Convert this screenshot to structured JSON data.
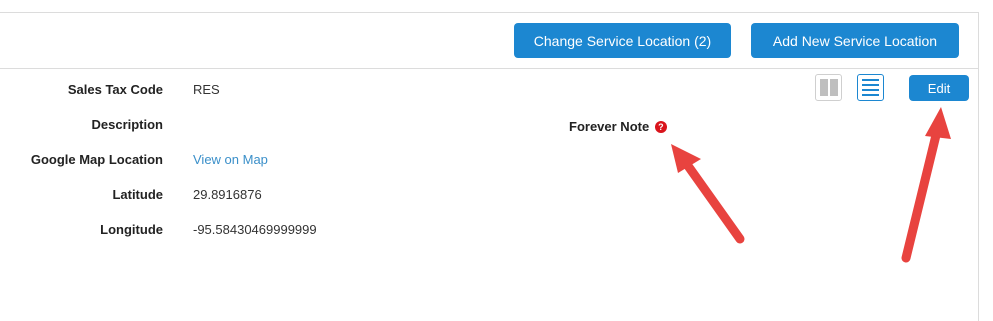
{
  "header": {
    "change_service_location": "Change Service Location (2)",
    "add_new_service_location": "Add New Service Location"
  },
  "toolbar": {
    "edit_label": "Edit"
  },
  "details": {
    "fields": [
      {
        "label": "Sales Tax Code",
        "value": "RES"
      },
      {
        "label": "Description",
        "value": ""
      },
      {
        "label": "Google Map Location",
        "value": "View on Map"
      },
      {
        "label": "Latitude",
        "value": "29.8916876"
      },
      {
        "label": "Longitude",
        "value": "-95.58430469999999"
      }
    ],
    "forever_note_label": "Forever Note",
    "help_glyph": "?"
  },
  "icons": {
    "column_view": "two-column-layout-icon",
    "list_view": "list-layout-icon",
    "help": "question-circle-icon"
  },
  "colors": {
    "primary": "#1c87d1",
    "link": "#3a8fc9",
    "help_icon": "#d9141c",
    "annotation_arrow": "#e8433f"
  }
}
